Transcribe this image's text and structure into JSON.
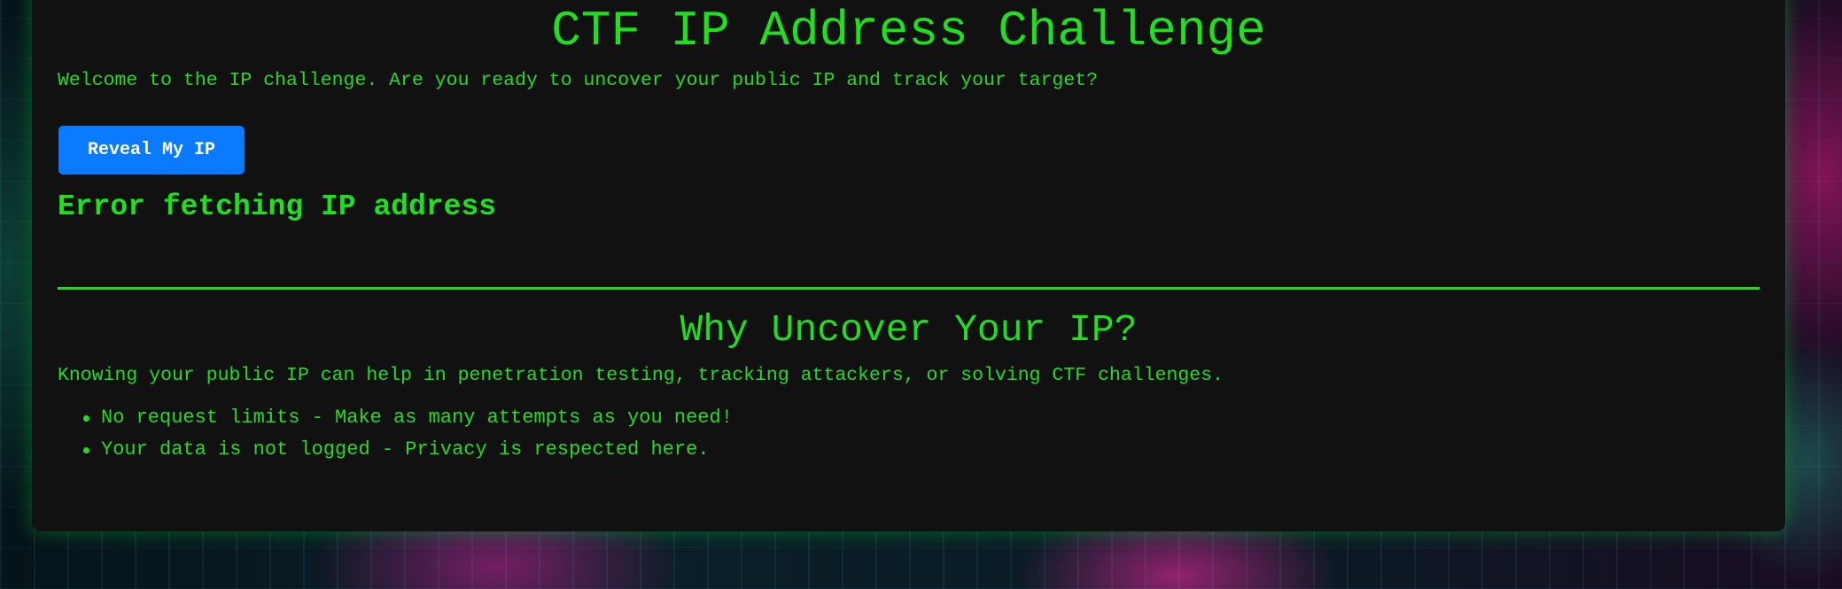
{
  "header": {
    "title": "CTF IP Address Challenge"
  },
  "intro": {
    "text": "Welcome to the IP challenge. Are you ready to uncover your public IP and track your target?"
  },
  "actions": {
    "reveal_label": "Reveal My IP"
  },
  "result": {
    "message": "Error fetching IP address"
  },
  "why": {
    "title": "Why Uncover Your IP?",
    "text": "Knowing your public IP can help in penetration testing, tracking attackers, or solving CTF challenges.",
    "bullets": [
      "No request limits - Make as many attempts as you need!",
      "Your data is not logged - Privacy is respected here."
    ]
  },
  "colors": {
    "text_green": "#22dd22",
    "card_bg": "#111111",
    "button_blue": "#0a7bff"
  }
}
